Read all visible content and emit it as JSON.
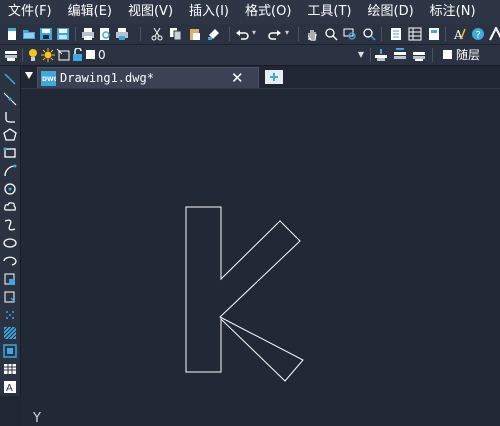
{
  "menu": {
    "items": [
      {
        "label": "文件(F)"
      },
      {
        "label": "编辑(E)"
      },
      {
        "label": "视图(V)"
      },
      {
        "label": "插入(I)"
      },
      {
        "label": "格式(O)"
      },
      {
        "label": "工具(T)"
      },
      {
        "label": "绘图(D)"
      },
      {
        "label": "标注(N)"
      }
    ]
  },
  "properties": {
    "layer_value": "0",
    "color_value": "随层"
  },
  "tabs": [
    {
      "label": "Drawing1.dwg*",
      "close": "✕",
      "icon": "dwg-file-icon"
    }
  ],
  "tab_strip": {
    "new_tab_icon": "new-tab-icon"
  },
  "canvas": {
    "ucs_label": "Y",
    "drawing": "letter-k-outline"
  },
  "colors": {
    "background": "#212836",
    "toolbar": "#2b3342",
    "menubar": "#2e3646",
    "accent": "#3ea8e0",
    "entity": "#ffffff"
  }
}
